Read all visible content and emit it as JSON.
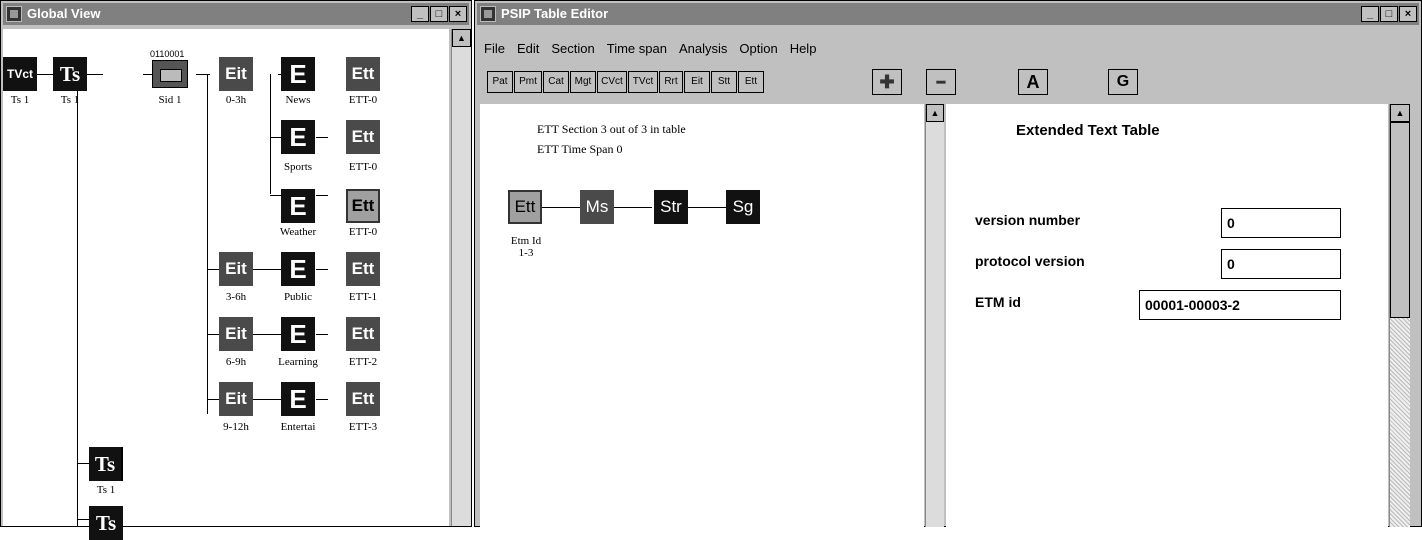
{
  "global_view": {
    "title": "Global View",
    "win_buttons": [
      "_",
      "□",
      "×"
    ],
    "nodes": {
      "tvct": "TVct",
      "ts_top": "Ts",
      "sid_bits": "0110001",
      "eit1": "Eit",
      "eit2": "Eit",
      "eit3": "Eit",
      "eit4": "Eit",
      "e": "E",
      "ett": "Ett",
      "ts2": "Ts",
      "ts3": "Ts"
    },
    "labels": {
      "tvct": "Ts 1",
      "ts": "Ts 1",
      "sid": "Sid 1",
      "eit1": "0-3h",
      "eit2": "3-6h",
      "eit3": "6-9h",
      "eit4": "9-12h",
      "e_news": "News",
      "e_sports": "Sports",
      "e_weather": "Weather",
      "e_public": "Public",
      "e_learning": "Learning",
      "e_entertai": "Entertai",
      "ett0a": "ETT-0",
      "ett0b": "ETT-0",
      "ett0c": "ETT-0",
      "ett1": "ETT-1",
      "ett2": "ETT-2",
      "ett3": "ETT-3",
      "ts2": "Ts 1"
    }
  },
  "psip": {
    "title": "PSIP Table Editor",
    "win_buttons": [
      "_",
      "□",
      "×"
    ],
    "menu": [
      "File",
      "Edit",
      "Section",
      "Time span",
      "Analysis",
      "Option",
      "Help"
    ],
    "toolbar": [
      "Pat",
      "Pmt",
      "Cat",
      "Mgt",
      "CVct",
      "TVct",
      "Rrt",
      "Eit",
      "Stt",
      "Ett"
    ],
    "big_buttons": {
      "add": "✚",
      "remove": "━",
      "a": "A",
      "g": "G"
    },
    "left": {
      "line1": "ETT Section 3 out of 3 in table",
      "line2": "ETT Time Span 0",
      "nodes": [
        "Ett",
        "Ms",
        "Str",
        "Sg"
      ],
      "node_label1": "Etm Id",
      "node_label2": "1-3"
    },
    "right": {
      "heading": "Extended Text Table",
      "version_label": "version number",
      "version_value": "0",
      "protocol_label": "protocol version",
      "protocol_value": "0",
      "etm_label": "ETM id",
      "etm_value": "00001-00003-2"
    }
  }
}
